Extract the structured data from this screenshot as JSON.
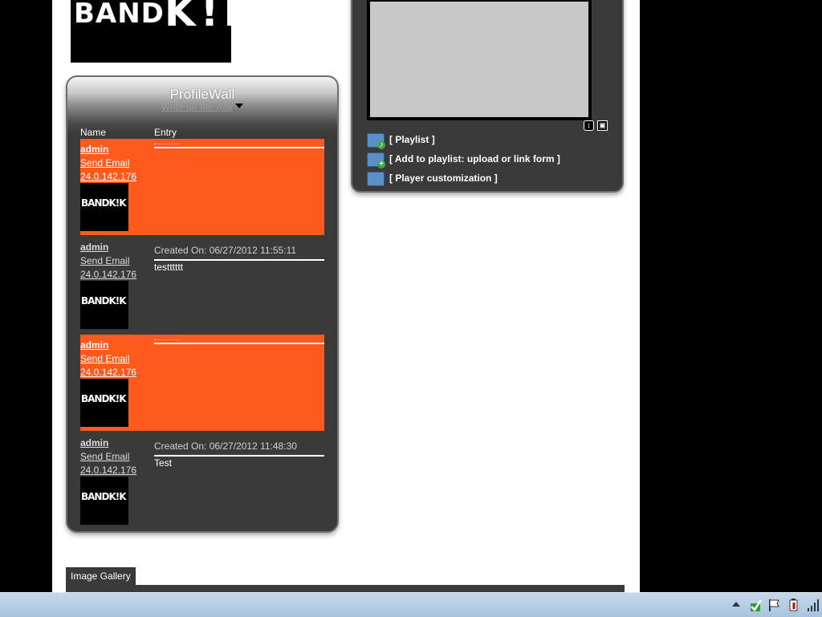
{
  "logo": {
    "text": "BAND",
    "mark": "K!K"
  },
  "profile_wall": {
    "title": "ProfileWall",
    "write_link": "Write on the wall",
    "columns": {
      "name": "Name",
      "entry": "Entry"
    },
    "entries": [
      {
        "author": "admin",
        "email_label": "Send Email",
        "ip": "24.0.142.176",
        "created": "",
        "text": "",
        "thumb_text": "BANDK!K"
      },
      {
        "author": "admin",
        "email_label": "Send Email",
        "ip": "24.0.142.176",
        "created": "Created On: 06/27/2012 11:55:11",
        "text": "testttttt",
        "thumb_text": "BANDK!K"
      },
      {
        "author": "admin",
        "email_label": "Send Email",
        "ip": "24.0.142.176",
        "created": "",
        "text": "",
        "thumb_text": "BANDK!K"
      },
      {
        "author": "admin",
        "email_label": "Send Email",
        "ip": "24.0.142.176",
        "created": "Created On: 06/27/2012 11:48:30",
        "text": "Test",
        "thumb_text": "BANDK!K"
      }
    ]
  },
  "player": {
    "links": [
      {
        "label": "[ Playlist ]",
        "icon": "playlist-folder-icon"
      },
      {
        "label": "[ Add to playlist: upload or link form ]",
        "icon": "add-folder-icon"
      },
      {
        "label": "[ Player customization ]",
        "icon": "customize-folder-icon"
      }
    ]
  },
  "gallery": {
    "tab_label": "Image Gallery"
  },
  "colors": {
    "highlight": "#ff5a1e",
    "panel": "#3a3a3a",
    "screen": "#c8c8c8"
  }
}
